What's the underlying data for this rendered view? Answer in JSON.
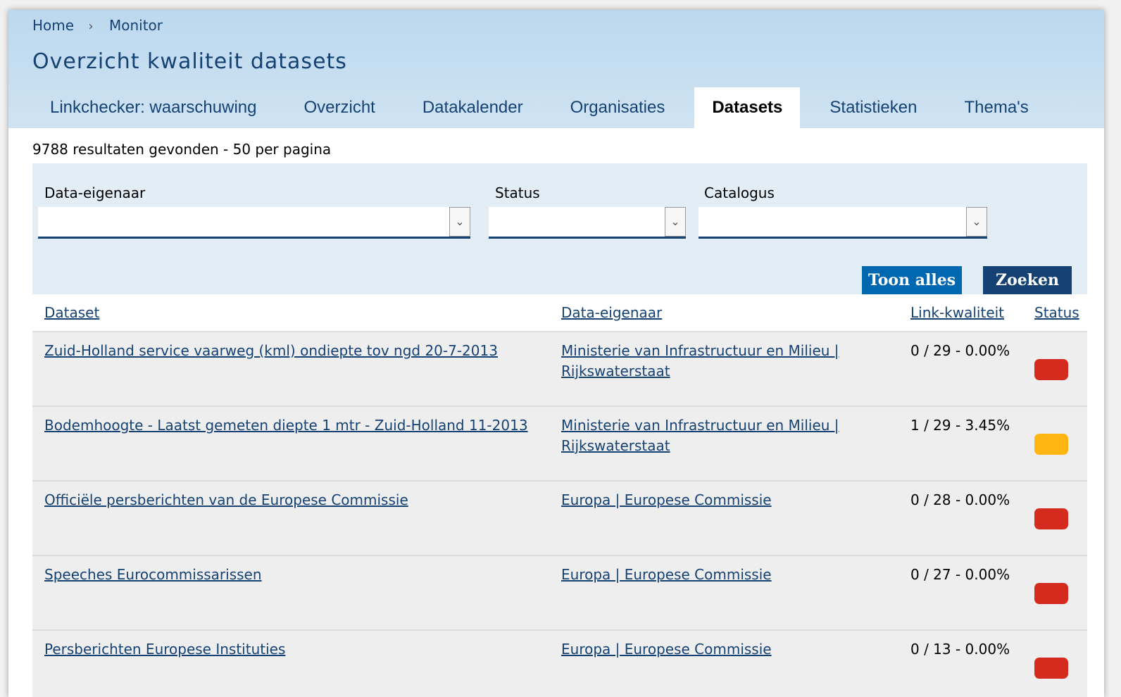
{
  "breadcrumb": {
    "home": "Home",
    "separator": "›",
    "current": "Monitor"
  },
  "page_title": "Overzicht kwaliteit datasets",
  "tabs": [
    {
      "label": "Linkchecker: waarschuwing",
      "active": false
    },
    {
      "label": "Overzicht",
      "active": false
    },
    {
      "label": "Datakalender",
      "active": false
    },
    {
      "label": "Organisaties",
      "active": false
    },
    {
      "label": "Datasets",
      "active": true
    },
    {
      "label": "Statistieken",
      "active": false
    },
    {
      "label": "Thema's",
      "active": false
    }
  ],
  "results_text": "9788 resultaten gevonden - 50 per pagina",
  "filters": {
    "owner": {
      "label": "Data-eigenaar",
      "value": ""
    },
    "status": {
      "label": "Status",
      "value": ""
    },
    "catalog": {
      "label": "Catalogus",
      "value": ""
    },
    "arrow": "⌄"
  },
  "buttons": {
    "show_all": "Toon alles",
    "search": "Zoeken"
  },
  "table": {
    "headers": {
      "dataset": "Dataset",
      "owner": "Data-eigenaar",
      "quality": "Link-kwaliteit",
      "status": "Status"
    },
    "rows": [
      {
        "dataset": "Zuid-Holland service vaarweg (kml) ondiepte tov ngd 20-7-2013",
        "owner_line1": "Ministerie van Infrastructuur en Milieu |",
        "owner_line2": "Rijkswaterstaat",
        "quality": "0 / 29 - 0.00%",
        "status_color": "#d52b1e"
      },
      {
        "dataset": "Bodemhoogte - Laatst gemeten diepte 1 mtr - Zuid-Holland 11-2013",
        "owner_line1": "Ministerie van Infrastructuur en Milieu |",
        "owner_line2": "Rijkswaterstaat",
        "quality": "1 / 29 - 3.45%",
        "status_color": "#ffb612"
      },
      {
        "dataset": "Officiële persberichten van de Europese Commissie",
        "owner_line1": "Europa | Europese Commissie",
        "owner_line2": "",
        "quality": "0 / 28 - 0.00%",
        "status_color": "#d52b1e"
      },
      {
        "dataset": "Speeches Eurocommissarissen",
        "owner_line1": "Europa | Europese Commissie",
        "owner_line2": "",
        "quality": "0 / 27 - 0.00%",
        "status_color": "#d52b1e"
      },
      {
        "dataset": "Persberichten Europese Instituties",
        "owner_line1": "Europa | Europese Commissie",
        "owner_line2": "",
        "quality": "0 / 13 - 0.00%",
        "status_color": "#d52b1e"
      }
    ]
  },
  "colors": {
    "header_bg": "#c4dcef",
    "brand_blue": "#154273",
    "btn_light": "#0067b1",
    "btn_dark": "#154273"
  }
}
